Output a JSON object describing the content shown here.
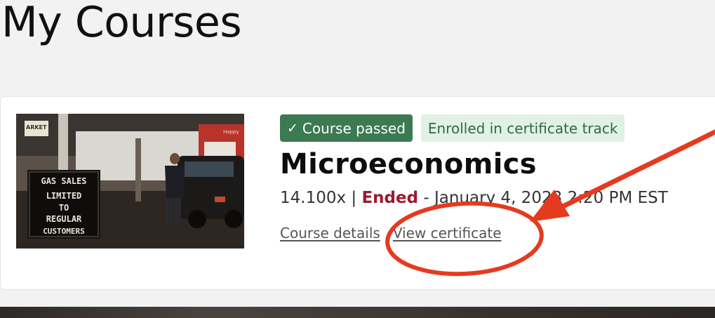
{
  "page": {
    "title": "My Courses"
  },
  "course": {
    "thumbnail_icon": "gas-station-photo",
    "thumbnail_sign": [
      "GAS SALES",
      "LIMITED",
      "TO",
      "REGULAR",
      "CUSTOMERS"
    ],
    "thumbnail_store_sign": "ARKET",
    "thumbnail_shop_sign": "Happy",
    "badge_passed": "Course passed",
    "badge_passed_icon": "checkmark-icon",
    "badge_track": "Enrolled in certificate track",
    "title": "Microeconomics",
    "code": "14.100x",
    "separator": "|",
    "status": "Ended",
    "date": "- January 4, 2023 2:20 PM EST",
    "links": {
      "details": "Course details",
      "certificate": "View certificate"
    }
  },
  "colors": {
    "badge_passed_bg": "#3c7a52",
    "badge_track_bg": "#e2f1e6",
    "ended": "#9b1a34",
    "annotation": "#e63a1f"
  }
}
